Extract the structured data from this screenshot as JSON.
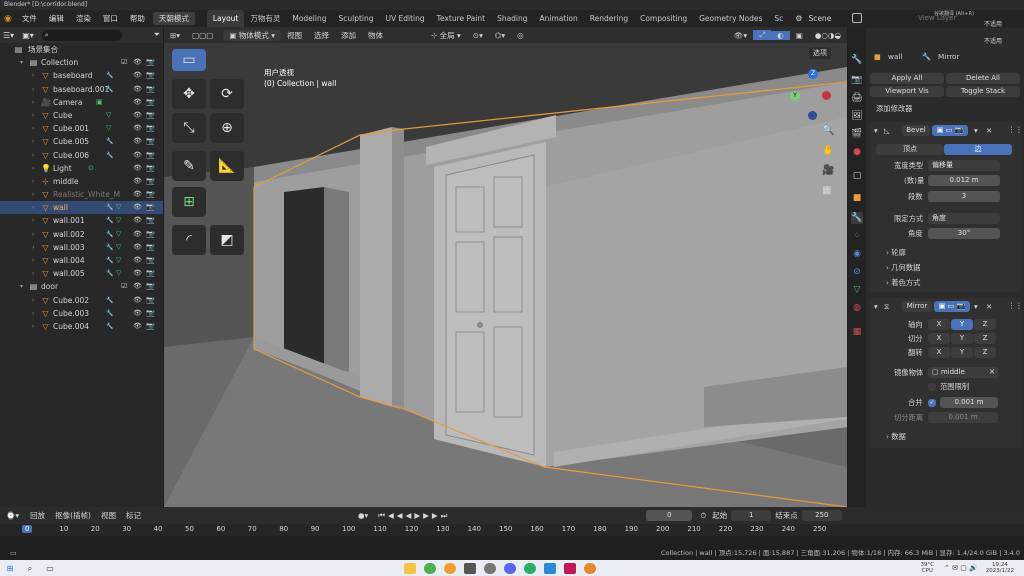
{
  "window": {
    "title": "Blender* [D:\\corridor.blend]"
  },
  "menu": {
    "items": [
      "文件",
      "编辑",
      "渲染",
      "窗口",
      "帮助"
    ],
    "highlighted": "天朝模式"
  },
  "workspaces": {
    "tabs": [
      "Layout",
      "万物有灵",
      "Modeling",
      "Sculpting",
      "UV Editing",
      "Texture Paint",
      "Shading",
      "Animation",
      "Rendering",
      "Compositing",
      "Geometry Nodes",
      "Sc"
    ],
    "active": "Layout"
  },
  "scene": {
    "label": "Scene",
    "right_labels": [
      "不适用",
      "不适用"
    ],
    "view_layer": "View Layer",
    "ime": "谷歌翻译 (Alt+R)"
  },
  "outliner": {
    "title": "场景集合",
    "rows": [
      {
        "label": "Collection",
        "depth": 1,
        "icon": "collection",
        "check": true
      },
      {
        "label": "baseboard",
        "depth": 2,
        "icon": "mesh",
        "wrench": true
      },
      {
        "label": "baseboard.001",
        "depth": 2,
        "icon": "mesh",
        "wrench": true
      },
      {
        "label": "Camera",
        "depth": 2,
        "icon": "camera",
        "green": true
      },
      {
        "label": "Cube",
        "depth": 2,
        "icon": "mesh",
        "tri": true
      },
      {
        "label": "Cube.001",
        "depth": 2,
        "icon": "mesh",
        "tri": true
      },
      {
        "label": "Cube.005",
        "depth": 2,
        "icon": "mesh",
        "wrench": true
      },
      {
        "label": "Cube.006",
        "depth": 2,
        "icon": "mesh",
        "wrench": true
      },
      {
        "label": "Light",
        "depth": 2,
        "icon": "light",
        "green": true
      },
      {
        "label": "middle",
        "depth": 2,
        "icon": "empty"
      },
      {
        "label": "Realistic_White_M",
        "depth": 2,
        "icon": "mesh",
        "dim": true
      },
      {
        "label": "wall",
        "depth": 2,
        "icon": "mesh",
        "wrench": true,
        "tri": true,
        "selected": true
      },
      {
        "label": "wall.001",
        "depth": 2,
        "icon": "mesh",
        "wrench": true,
        "tri": true
      },
      {
        "label": "wall.002",
        "depth": 2,
        "icon": "mesh",
        "wrench": true,
        "tri": true
      },
      {
        "label": "wall.003",
        "depth": 2,
        "icon": "mesh",
        "wrench": true,
        "tri": true
      },
      {
        "label": "wall.004",
        "depth": 2,
        "icon": "mesh",
        "wrench": true,
        "tri": true
      },
      {
        "label": "wall.005",
        "depth": 2,
        "icon": "mesh",
        "wrench": true,
        "tri": true
      },
      {
        "label": "door",
        "depth": 1,
        "icon": "collection",
        "check": true
      },
      {
        "label": "Cube.002",
        "depth": 2,
        "icon": "mesh",
        "wrench": true
      },
      {
        "label": "Cube.003",
        "depth": 2,
        "icon": "mesh",
        "wrench": true
      },
      {
        "label": "Cube.004",
        "depth": 2,
        "icon": "mesh",
        "wrench": true
      }
    ]
  },
  "viewport": {
    "mode": "物体模式",
    "menus": [
      "视图",
      "选择",
      "添加",
      "物体"
    ],
    "transform": "全局",
    "options": "选项",
    "overlay_title": "用户透视",
    "overlay_sub": "(0) Collection | wall",
    "gizmo": {
      "x": "X",
      "y": "Y",
      "z": "Z"
    }
  },
  "properties": {
    "object": "wall",
    "modifier_ctx": "Mirror",
    "apply_all": "Apply All",
    "delete_all": "Delete All",
    "viewport_vis": "Viewport Vis",
    "toggle_stack": "Toggle Stack",
    "add_modifier": "添加修改器",
    "bevel": {
      "name": "Bevel",
      "tab_vertex": "顶点",
      "tab_edge": "边",
      "width_type_label": "宽度类型",
      "width_type": "偏移量",
      "amount_label": "(数)量",
      "amount": "0.012 m",
      "segments_label": "段数",
      "segments": "3",
      "limit_label": "限定方式",
      "limit": "角度",
      "angle_label": "角度",
      "angle": "30°",
      "sections": [
        "轮廓",
        "几何数据",
        "着色方式"
      ]
    },
    "mirror": {
      "name": "Mirror",
      "axis_label": "轴向",
      "bisect_label": "切分",
      "flip_label": "翻转",
      "axes": [
        "X",
        "Y",
        "Z"
      ],
      "mirror_obj_label": "镜像物体",
      "mirror_obj": "middle",
      "clip_label": "范围限制",
      "merge_label": "合并",
      "merge": "0.001 m",
      "bisect_dist_label": "切分距离",
      "bisect_dist": "0.001 m",
      "data_section": "数据"
    }
  },
  "timeline": {
    "menus": [
      "回放",
      "抠像(插帧)",
      "视图",
      "标记"
    ],
    "current_frame": "0",
    "start_label": "起始",
    "start": "1",
    "end_label": "结束点",
    "end": "250",
    "ticks": [
      "0",
      "10",
      "20",
      "30",
      "40",
      "50",
      "60",
      "70",
      "80",
      "90",
      "100",
      "110",
      "120",
      "130",
      "140",
      "150",
      "160",
      "170",
      "180",
      "190",
      "200",
      "210",
      "220",
      "230",
      "240",
      "250"
    ]
  },
  "status": {
    "text": "Collection | wall | 顶点:15,726 | 面:15,887 | 三角面:31,206 | 物体:1/18 | 内存: 66.3 MiB | 显存: 1.4/24.0 GiB | 3.4.0"
  },
  "taskbar": {
    "temp": "39°C",
    "temp_label": "CPU",
    "time": "19:24",
    "date": "2023/1/22"
  }
}
